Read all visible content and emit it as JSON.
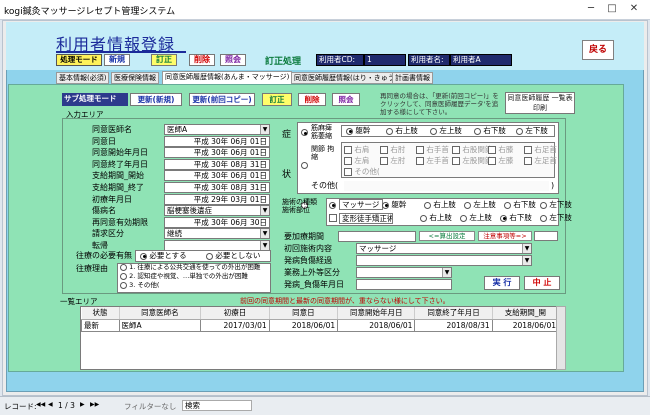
{
  "window": {
    "title": "kogi鍼灸マッサージレセプト管理システム",
    "minimize": "─",
    "maximize": "□",
    "close": "✕"
  },
  "header": {
    "heading": "利用者情報登録",
    "mode_label": "処理モード",
    "new": "新規",
    "correct": "訂正",
    "delete": "削除",
    "view": "照会",
    "status": "訂正処理",
    "user_cd_label": "利用者CD:",
    "user_cd": "1",
    "user_name_label": "利用者名:",
    "user_name": "利用者A",
    "back": "戻る"
  },
  "tabs": [
    "基本情報(必須)",
    "医療保険情報",
    "同意医師履歴情報(あんま・マッサージ)",
    "同意医師履歴情報(はり・きゅう)",
    "計画書情報"
  ],
  "sub": {
    "label": "サブ処理モード",
    "new": "更新(新規)",
    "copy": "更新(前回コピー)",
    "correct": "訂正",
    "delete": "削除",
    "view": "照会",
    "note": "再同意の場合は、「更新(前回コピー)」をクリックして、同意医師履歴データ'を追加する様にして下さい。",
    "print": "同意医師履歴 一覧表印刷"
  },
  "input_area": "入力エリア",
  "form": {
    "labels": [
      "同意医師名",
      "同意日",
      "同意開始年月日",
      "同意終了年月日",
      "支給期間_開始",
      "支給期間_終了",
      "初療年月日",
      "傷病名",
      "再同意有効期限",
      "請求区分",
      "転帰"
    ],
    "values": [
      "医師A",
      "平成 30年 06月 01日",
      "平成 30年 06月 01日",
      "平成 30年 08月 31日",
      "平成 30年 06月 01日",
      "平成 30年 08月 31日",
      "平成 29年 03月 01日",
      "脳梗塞後遺症",
      "平成 30年 06月 30日",
      "継続",
      ""
    ],
    "dropdown_rows": [
      0,
      7,
      9,
      10
    ],
    "outing_label": "往療の必要有無",
    "outing_need": "必要とする",
    "outing_noneed": "必要としない",
    "reason_label": "往療理由",
    "reasons": [
      "1. 往療による公共交通を使っての外出が困難",
      "2. 認知症や視覚、…単独での外出が困難",
      "3. その他("
    ],
    "symptom_label_1": "症",
    "symptom_label_2": "状",
    "muscle_label": "筋麻痺 筋萎縮",
    "joint_label": "関節 拘縮",
    "other_label": "その他(",
    "sites_row1": [
      "躯幹",
      "右上肢",
      "左上肢",
      "右下肢",
      "左下肢"
    ],
    "sites_row2": [
      "右肩",
      "右肘",
      "右手首",
      "右股関節",
      "右膝",
      "右足首"
    ],
    "sites_row3": [
      "左肩",
      "左肘",
      "左手首",
      "左股関節",
      "左膝",
      "左足首"
    ],
    "sites_row4": "その他(",
    "treat_label": "施術の種類 施術部位",
    "massage": "マッサージ",
    "fix": "変形徒手矯正術",
    "treat_sites": [
      "躯幹",
      "右上肢",
      "左上肢",
      "右下肢",
      "左下肢"
    ],
    "treat_sites2": [
      "右上肢",
      "左上肢",
      "右下肢",
      "左下肢"
    ],
    "req_label": "要加療期間",
    "calc": "<=算出設定",
    "notes_btn": "注意事項等=>",
    "first_label": "初回施術内容",
    "first_val": "マッサージ",
    "burden_label": "発病負傷経過",
    "outside_label": "業務上外等区分",
    "date_label": "発病_負傷年月日",
    "exec": "実 行",
    "cancel": "中 止"
  },
  "list": {
    "area_label": "一覧エリア",
    "warn": "前回の同意期間と最新の同意期間が、重ならない様にして下さい。",
    "headers": [
      "状態",
      "同意医師名",
      "初療日",
      "同意日",
      "同意開始年月日",
      "同意終了年月日",
      "支給期間_開"
    ],
    "rows": [
      [
        "最新",
        "医師A",
        "2017/03/01",
        "2018/06/01",
        "2018/06/01",
        "2018/08/31",
        "2018/06/01"
      ]
    ]
  },
  "statusbar": {
    "record": "レコード:",
    "nav_first": "◀◀",
    "nav_prev": "◀",
    "pos": "1 / 3",
    "nav_next": "▶",
    "nav_last": "▶▶",
    "filter": "フィルターなし",
    "search": "検索"
  }
}
